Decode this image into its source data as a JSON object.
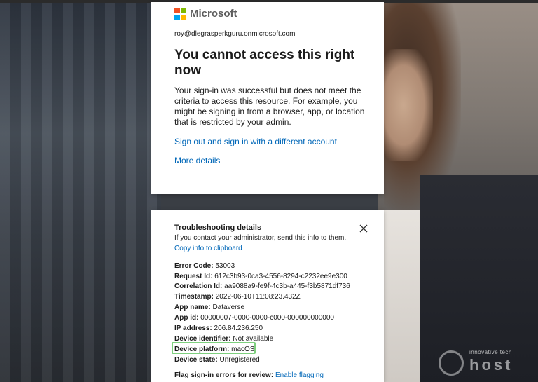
{
  "brand": {
    "name": "Microsoft",
    "colors": [
      "#f25022",
      "#7fba00",
      "#00a4ef",
      "#ffb900"
    ]
  },
  "card1": {
    "email": "roy@dlegrasperkguru.onmicrosoft.com",
    "title": "You cannot access this right now",
    "description": "Your sign-in was successful but does not meet the criteria to access this resource. For example, you might be signing in from a browser, app, or location that is restricted by your admin.",
    "signout_link": "Sign out and sign in with a different account",
    "more_details_link": "More details"
  },
  "card2": {
    "title": "Troubleshooting details",
    "subtitle": "If you contact your administrator, send this info to them.",
    "copy_link": "Copy info to clipboard",
    "close_icon": "close-icon",
    "details": [
      {
        "label": "Error Code:",
        "value": "53003"
      },
      {
        "label": "Request Id:",
        "value": "612c3b93-0ca3-4556-8294-c2232ee9e300"
      },
      {
        "label": "Correlation Id:",
        "value": "aa9088a9-fe9f-4c3b-a445-f3b5871df736"
      },
      {
        "label": "Timestamp:",
        "value": "2022-06-10T11:08:23.432Z"
      },
      {
        "label": "App name:",
        "value": "Dataverse"
      },
      {
        "label": "App id:",
        "value": "00000007-0000-0000-c000-000000000000"
      },
      {
        "label": "IP address:",
        "value": "206.84.236.250"
      },
      {
        "label": "Device identifier:",
        "value": "Not available"
      },
      {
        "label": "Device platform:",
        "value": "macOS"
      },
      {
        "label": "Device state:",
        "value": "Unregistered"
      }
    ],
    "flag_label": "Flag sign-in errors for review:",
    "flag_link": "Enable flagging",
    "highlight_color": "#7ed07e"
  },
  "watermark": {
    "text": "host",
    "small": "innovative tech"
  }
}
